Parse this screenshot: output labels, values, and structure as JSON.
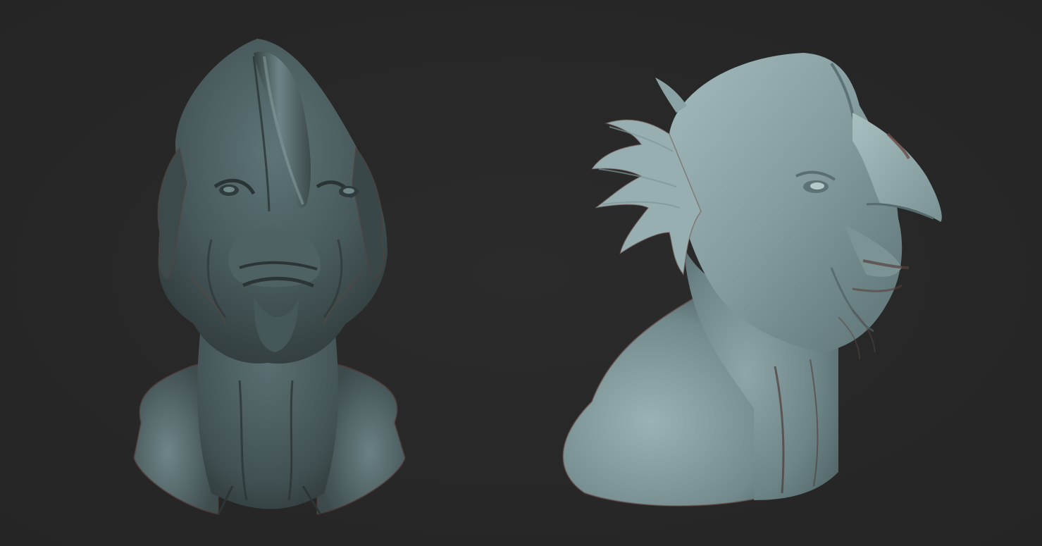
{
  "scene": {
    "background_color": "#282828",
    "material_color": "#6d8a8c",
    "shadow_color": "#3a4648",
    "highlight_color": "#a9c2c3",
    "rim_color": "#8b5a52"
  },
  "models": [
    {
      "name": "creature-bust-front-view",
      "view": "front"
    },
    {
      "name": "creature-bust-side-view",
      "view": "three-quarter-side"
    }
  ]
}
